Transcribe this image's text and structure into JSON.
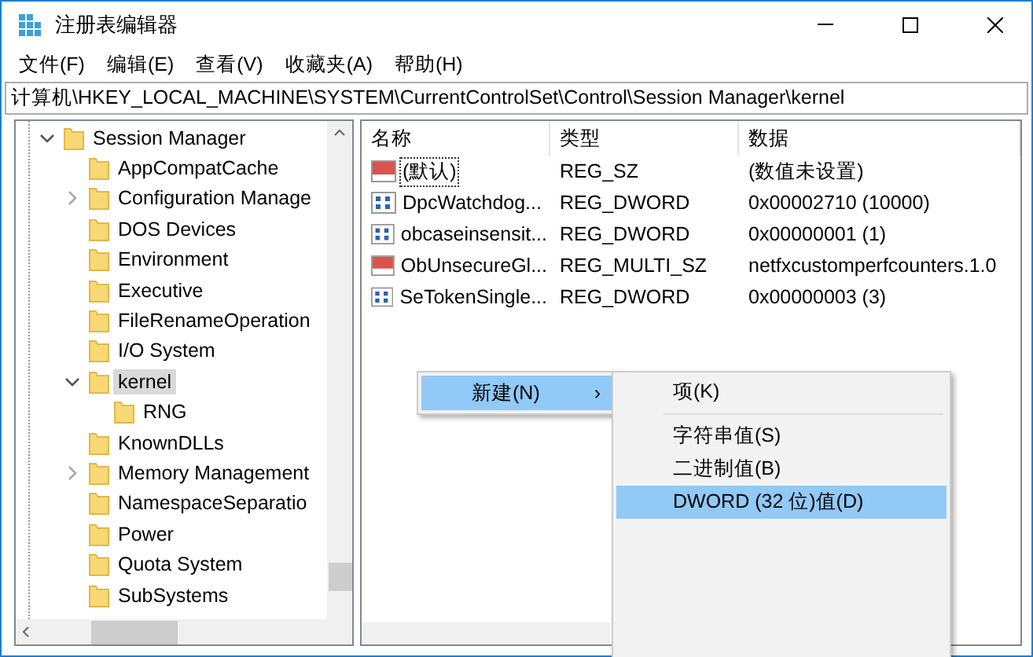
{
  "window": {
    "title": "注册表编辑器"
  },
  "menu_bar": [
    "文件(F)",
    "编辑(E)",
    "查看(V)",
    "收藏夹(A)",
    "帮助(H)"
  ],
  "address": "计算机\\HKEY_LOCAL_MACHINE\\SYSTEM\\CurrentControlSet\\Control\\Session Manager\\kernel",
  "tree": [
    {
      "label": "Session Manager",
      "expanded": true,
      "selected": false,
      "children": [
        {
          "label": "AppCompatCache",
          "selected": false
        },
        {
          "label": "Configuration Manage",
          "expanded": false,
          "selected": false
        },
        {
          "label": "DOS Devices",
          "selected": false
        },
        {
          "label": "Environment",
          "selected": false
        },
        {
          "label": "Executive",
          "selected": false
        },
        {
          "label": "FileRenameOperation",
          "selected": false
        },
        {
          "label": "I/O System",
          "selected": false
        },
        {
          "label": "kernel",
          "expanded": true,
          "selected": true,
          "children": [
            {
              "label": "RNG",
              "selected": false
            }
          ]
        },
        {
          "label": "KnownDLLs",
          "selected": false
        },
        {
          "label": "Memory Management",
          "expanded": false,
          "selected": false
        },
        {
          "label": "NamespaceSeparatio",
          "selected": false
        },
        {
          "label": "Power",
          "selected": false
        },
        {
          "label": "Quota System",
          "selected": false
        },
        {
          "label": "SubSystems",
          "selected": false
        }
      ]
    }
  ],
  "table": {
    "columns": [
      "名称",
      "类型",
      "数据"
    ],
    "rows": [
      {
        "kind": "string",
        "name": "(默认)",
        "type": "REG_SZ",
        "data": "(数值未设置)",
        "focused": true
      },
      {
        "kind": "binary",
        "name": "DpcWatchdog...",
        "type": "REG_DWORD",
        "data": "0x00002710 (10000)",
        "focused": false
      },
      {
        "kind": "binary",
        "name": "obcaseinsensit...",
        "type": "REG_DWORD",
        "data": "0x00000001 (1)",
        "focused": false
      },
      {
        "kind": "string",
        "name": "ObUnsecureGl...",
        "type": "REG_MULTI_SZ",
        "data": "netfxcustomperfcounters.1.0",
        "focused": false
      },
      {
        "kind": "binary",
        "name": "SeTokenSingle...",
        "type": "REG_DWORD",
        "data": "0x00000003 (3)",
        "focused": false
      }
    ]
  },
  "context_menu": {
    "items": [
      {
        "label": "新建(N)",
        "arrow": "›",
        "selected": true
      }
    ]
  },
  "submenu": {
    "items": [
      {
        "kind": "item",
        "label": "项(K)",
        "selected": false
      },
      {
        "kind": "separator"
      },
      {
        "kind": "item",
        "label": "字符串值(S)",
        "selected": false
      },
      {
        "kind": "item",
        "label": "二进制值(B)",
        "selected": false
      },
      {
        "kind": "item",
        "label": "DWORD (32 位)值(D)",
        "selected": true
      }
    ]
  }
}
